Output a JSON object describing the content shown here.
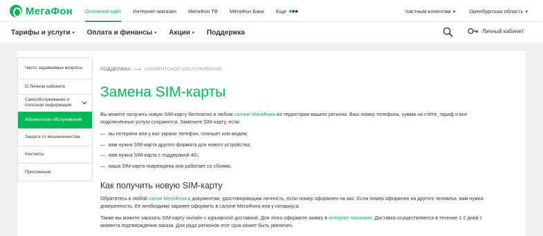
{
  "brand": {
    "name": "МегаФон",
    "accent": "#00b956"
  },
  "topbar": {
    "links": [
      {
        "label": "Основной сайт",
        "active": true
      },
      {
        "label": "Интернет-магазин"
      },
      {
        "label": "МегаФон ТВ"
      },
      {
        "label": "МегаФон Банк"
      },
      {
        "label": "Еще"
      }
    ],
    "audience": "Частным клиентам",
    "region": "Оренбургская область"
  },
  "nav": {
    "items": [
      {
        "label": "Тарифы и услуги"
      },
      {
        "label": "Оплата и финансы"
      },
      {
        "label": "Акции"
      },
      {
        "label": "Поддержка"
      }
    ],
    "cabinet_label": "Личный кабинет"
  },
  "sidebar": {
    "items": [
      {
        "label": "Часто задаваемые вопросы"
      },
      {
        "label": "О Личном кабинете"
      },
      {
        "label": "Самообслуживание и полезная информация",
        "expandable": true
      },
      {
        "label": "Абонентское обслуживание",
        "active": true
      },
      {
        "label": "Защита от мошенничества"
      },
      {
        "label": "Контакты"
      },
      {
        "label": "Приложения"
      }
    ]
  },
  "breadcrumb": {
    "parent": "ПОДДЕРЖКА",
    "current": "АБОНЕНТСКОЕ ОБСЛУЖИВАНИЕ"
  },
  "article": {
    "title": "Замена SIM-карты",
    "intro": {
      "before": "Вы можете получить новую SIM-карту бесплатно в любом ",
      "link": "салоне МегаФона",
      "after": " на территории вашего региона. Ваш номер телефона, сумма на счёте, тариф и все подключённые услуги сохранятся. Замените SIM-карту, если:"
    },
    "bullets": [
      "вы потеряли или у вас украли телефон, планшет или модем;",
      "вам нужна SIM-карта другого формата для нового устройства;",
      "вам нужна SIM-карта с поддержкой 4G;",
      "ваша SIM-карта повреждена или работает со сбоями."
    ],
    "subtitle": "Как получить новую SIM-карту",
    "p2": {
      "before": "Обратитесь в любой ",
      "link": "салон МегаФона",
      "after": " с документом, удостоверяющим личность, если номер оформлен на вас. Если номер оформлен на другого человека, вам нужна доверенность. Её необходимо заранее оформить в салоне МегаФона или у нотариуса."
    },
    "p3": {
      "before": "Также вы можете заказать SIM-карту онлайн с курьерской доставкой. Для этого оформите заявку в ",
      "link": "интернет-магазине",
      "after": ". Доставка осуществляется в течение 1-2 дней с момента подтверждения заказа. Для ряда регионов этот срок может быть увеличен."
    }
  }
}
